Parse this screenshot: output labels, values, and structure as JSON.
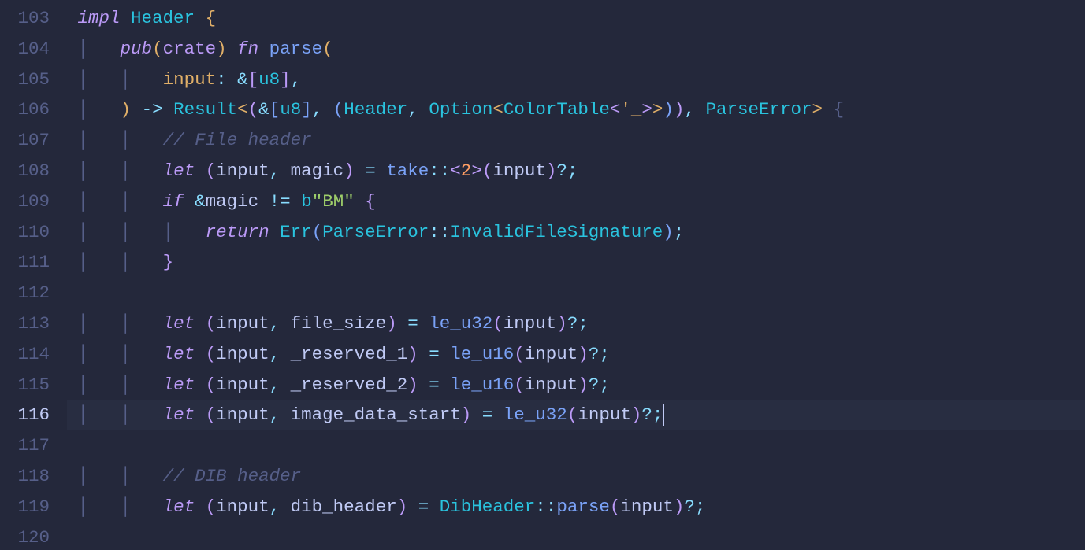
{
  "gutter": {
    "start": 103,
    "end": 120,
    "current": 116,
    "lines": [
      "103",
      "104",
      "105",
      "106",
      "107",
      "108",
      "109",
      "110",
      "111",
      "112",
      "113",
      "114",
      "115",
      "116",
      "117",
      "118",
      "119",
      "120"
    ]
  },
  "tokens": {
    "kw_impl": "impl",
    "kw_pub": "pub",
    "kw_crate": "crate",
    "kw_fn": "fn",
    "kw_let": "let",
    "kw_if": "if",
    "kw_return": "return",
    "type_header": "Header",
    "type_option": "Option",
    "type_colortable": "ColorTable",
    "type_result": "Result",
    "type_u8": "u8",
    "type_parseerror": "ParseError",
    "type_dibheader": "DibHeader",
    "fn_parse": "parse",
    "fn_take": "take",
    "fn_le_u32": "le_u32",
    "fn_le_u16": "le_u16",
    "fn_err": "Err",
    "var_input": "input",
    "var_magic": "magic",
    "var_file_size": "file_size",
    "var_reserved_1": "_reserved_1",
    "var_reserved_2": "_reserved_2",
    "var_image_data_start": "image_data_start",
    "var_dib_header": "dib_header",
    "variant_invalidsig": "InvalidFileSignature",
    "lifetime_wild": "'_",
    "byte_prefix": "b",
    "str_bm": "\"BM\"",
    "num_2": "2",
    "comment_file_header": "// File header",
    "comment_dib_header": "// DIB header",
    "arrow": "->",
    "turbofish": "::",
    "amp": "&",
    "neq": "!=",
    "eq": "=",
    "comma": ",",
    "colon": ":",
    "semi": ";",
    "qmark": "?",
    "lt": "<",
    "gt": ">",
    "lparen": "(",
    "rparen": ")",
    "lbrack": "[",
    "rbrack": "]",
    "lbrace": "{",
    "rbrace": "}"
  }
}
